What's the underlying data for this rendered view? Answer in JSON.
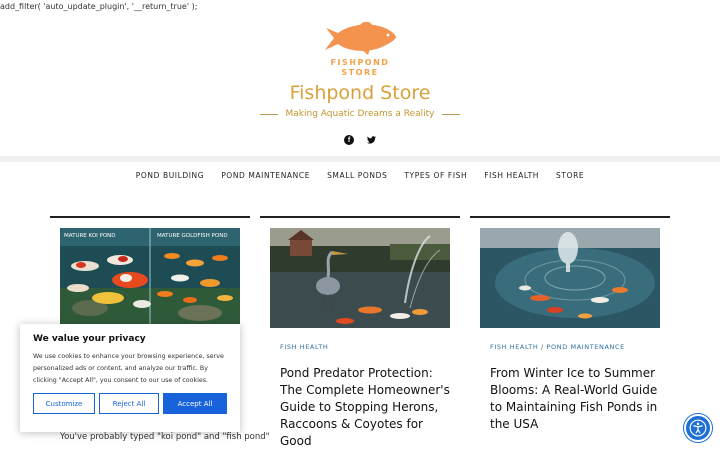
{
  "php_line": "add_filter( 'auto_update_plugin', '__return_true' );",
  "header": {
    "logo_text_line1": "FISHPOND",
    "logo_text_line2": "STORE",
    "site_title": "Fishpond Store",
    "tagline": "Making Aquatic Dreams a Reality",
    "social": [
      "facebook-icon",
      "twitter-icon"
    ]
  },
  "nav": {
    "items": [
      {
        "label": "POND BUILDING"
      },
      {
        "label": "POND MAINTENANCE"
      },
      {
        "label": "SMALL PONDS"
      },
      {
        "label": "TYPES OF FISH"
      },
      {
        "label": "FISH HEALTH"
      },
      {
        "label": "STORE"
      }
    ]
  },
  "posts": [
    {
      "image_label_left": "MATURE KOI POND",
      "image_label_right": "MATURE GOLDFISH POND",
      "excerpt": "You've probably typed \"koi pond\" and \"fish pond\""
    },
    {
      "category": "FISH HEALTH",
      "title": "Pond Predator Protection: The Complete Homeowner's Guide to Stopping Herons, Raccoons & Coyotes for Good"
    },
    {
      "category1": "FISH HEALTH",
      "category_sep": "/",
      "category2": "POND MAINTENANCE",
      "title": "From Winter Ice to Summer Blooms: A Real-World Guide to Maintaining Fish Ponds in the USA"
    }
  ],
  "cookie": {
    "heading": "We value your privacy",
    "body": "We use cookies to enhance your browsing experience, serve personalized ads or content, and analyze our traffic. By clicking \"Accept All\", you consent to our use of cookies.",
    "customize": "Customize",
    "reject": "Reject All",
    "accept": "Accept All"
  },
  "colors": {
    "accent_gold": "#d9a13a",
    "logo_orange": "#f2a24b",
    "link_blue": "#2b6ea0",
    "button_blue": "#1863dc"
  }
}
